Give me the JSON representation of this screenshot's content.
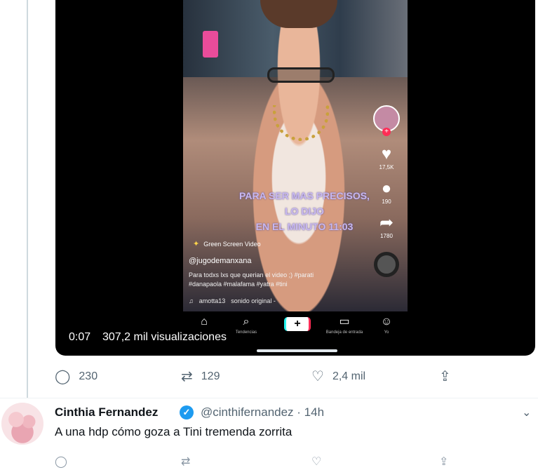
{
  "video": {
    "overlay_lines": [
      "PARA SER MAS PRECISOS, LO DIJO",
      "EN EL MINUTO 11:03"
    ],
    "green_screen_label": "Green Screen Video",
    "tiktok_handle": "@jugodemanxana",
    "caption_line1": "Para todxs lxs que querian el video ;) #parati",
    "caption_line2": "#danapaola #malafama #yatra #tini",
    "sound_user": "amotta13",
    "sound_name": "sonido original -",
    "likes": "17,5K",
    "comments": "190",
    "shares": "1780",
    "nav": {
      "trends": "Tendencias",
      "inbox": "Bandeja de entrada",
      "me": "Yo"
    },
    "time": "0:07",
    "views": "307,2 mil visualizaciones"
  },
  "tweet_actions": {
    "replies": "230",
    "retweets": "129",
    "likes": "2,4 mil"
  },
  "reply_tweet": {
    "name": "Cinthia Fernandez",
    "handle": "@cinthifernandez",
    "time": "· 14h",
    "text": "A una hdp cómo goza a Tini tremenda zorrita"
  },
  "colors": {
    "accent": "#1d9bf0",
    "muted": "#536471"
  }
}
